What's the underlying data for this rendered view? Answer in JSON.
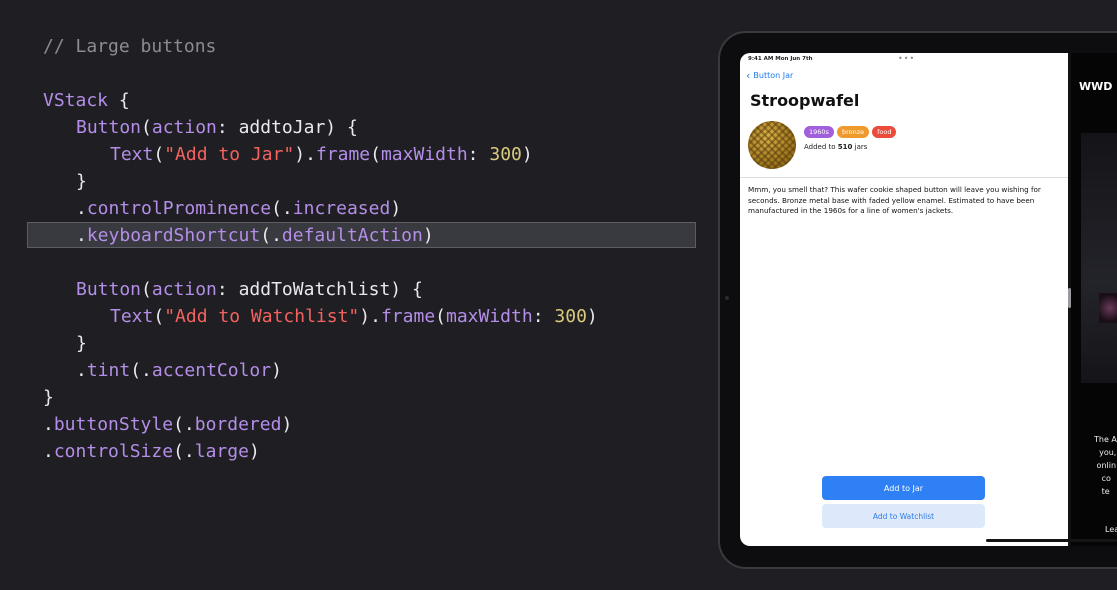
{
  "code": {
    "lines": [
      "// Large buttons",
      "VStack {",
      "Button(action: addtoJar) {",
      "Text(\"Add to Jar\").frame(maxWidth: 300)",
      "}",
      ".controlProminence(.increased)",
      ".keyboardShortcut(.defaultAction)",
      "Button(action: addToWatchlist) {",
      "Text(\"Add to Watchlist\").frame(maxWidth: 300)",
      "}",
      ".tint(.accentColor)",
      "}",
      ".buttonStyle(.bordered)",
      ".controlSize(.large)"
    ],
    "highlighted_line": ".keyboardShortcut(.defaultAction)"
  },
  "ipad": {
    "status": {
      "time": "9:41 AM  Mon Jun 7th",
      "dots": "•••"
    },
    "back_label": "Button Jar",
    "title": "Stroopwafel",
    "tags": [
      "1960s",
      "bronze",
      "food"
    ],
    "added_prefix": "Added to ",
    "added_count": "510",
    "added_suffix": " jars",
    "description": "Mmm, you smell that? This wafer cookie shaped button will leave you wishing for seconds. Bronze metal base with faded yellow enamel. Estimated to have been manufactured in the 1960s for a line of women's jackets.",
    "primary_button": "Add to Jar",
    "secondary_button": "Add to Watchlist",
    "right_pane": {
      "brand": "WWD",
      "text": "The A\n  you,\n onlin\n   co\n   te",
      "learn": "Lea"
    }
  },
  "colors": {
    "code_background": "#1f1f23",
    "keyword_purple": "#b48ee8",
    "string_red": "#f2635f",
    "number_yellow": "#d9c97c",
    "accent_blue": "#2f80f4"
  }
}
